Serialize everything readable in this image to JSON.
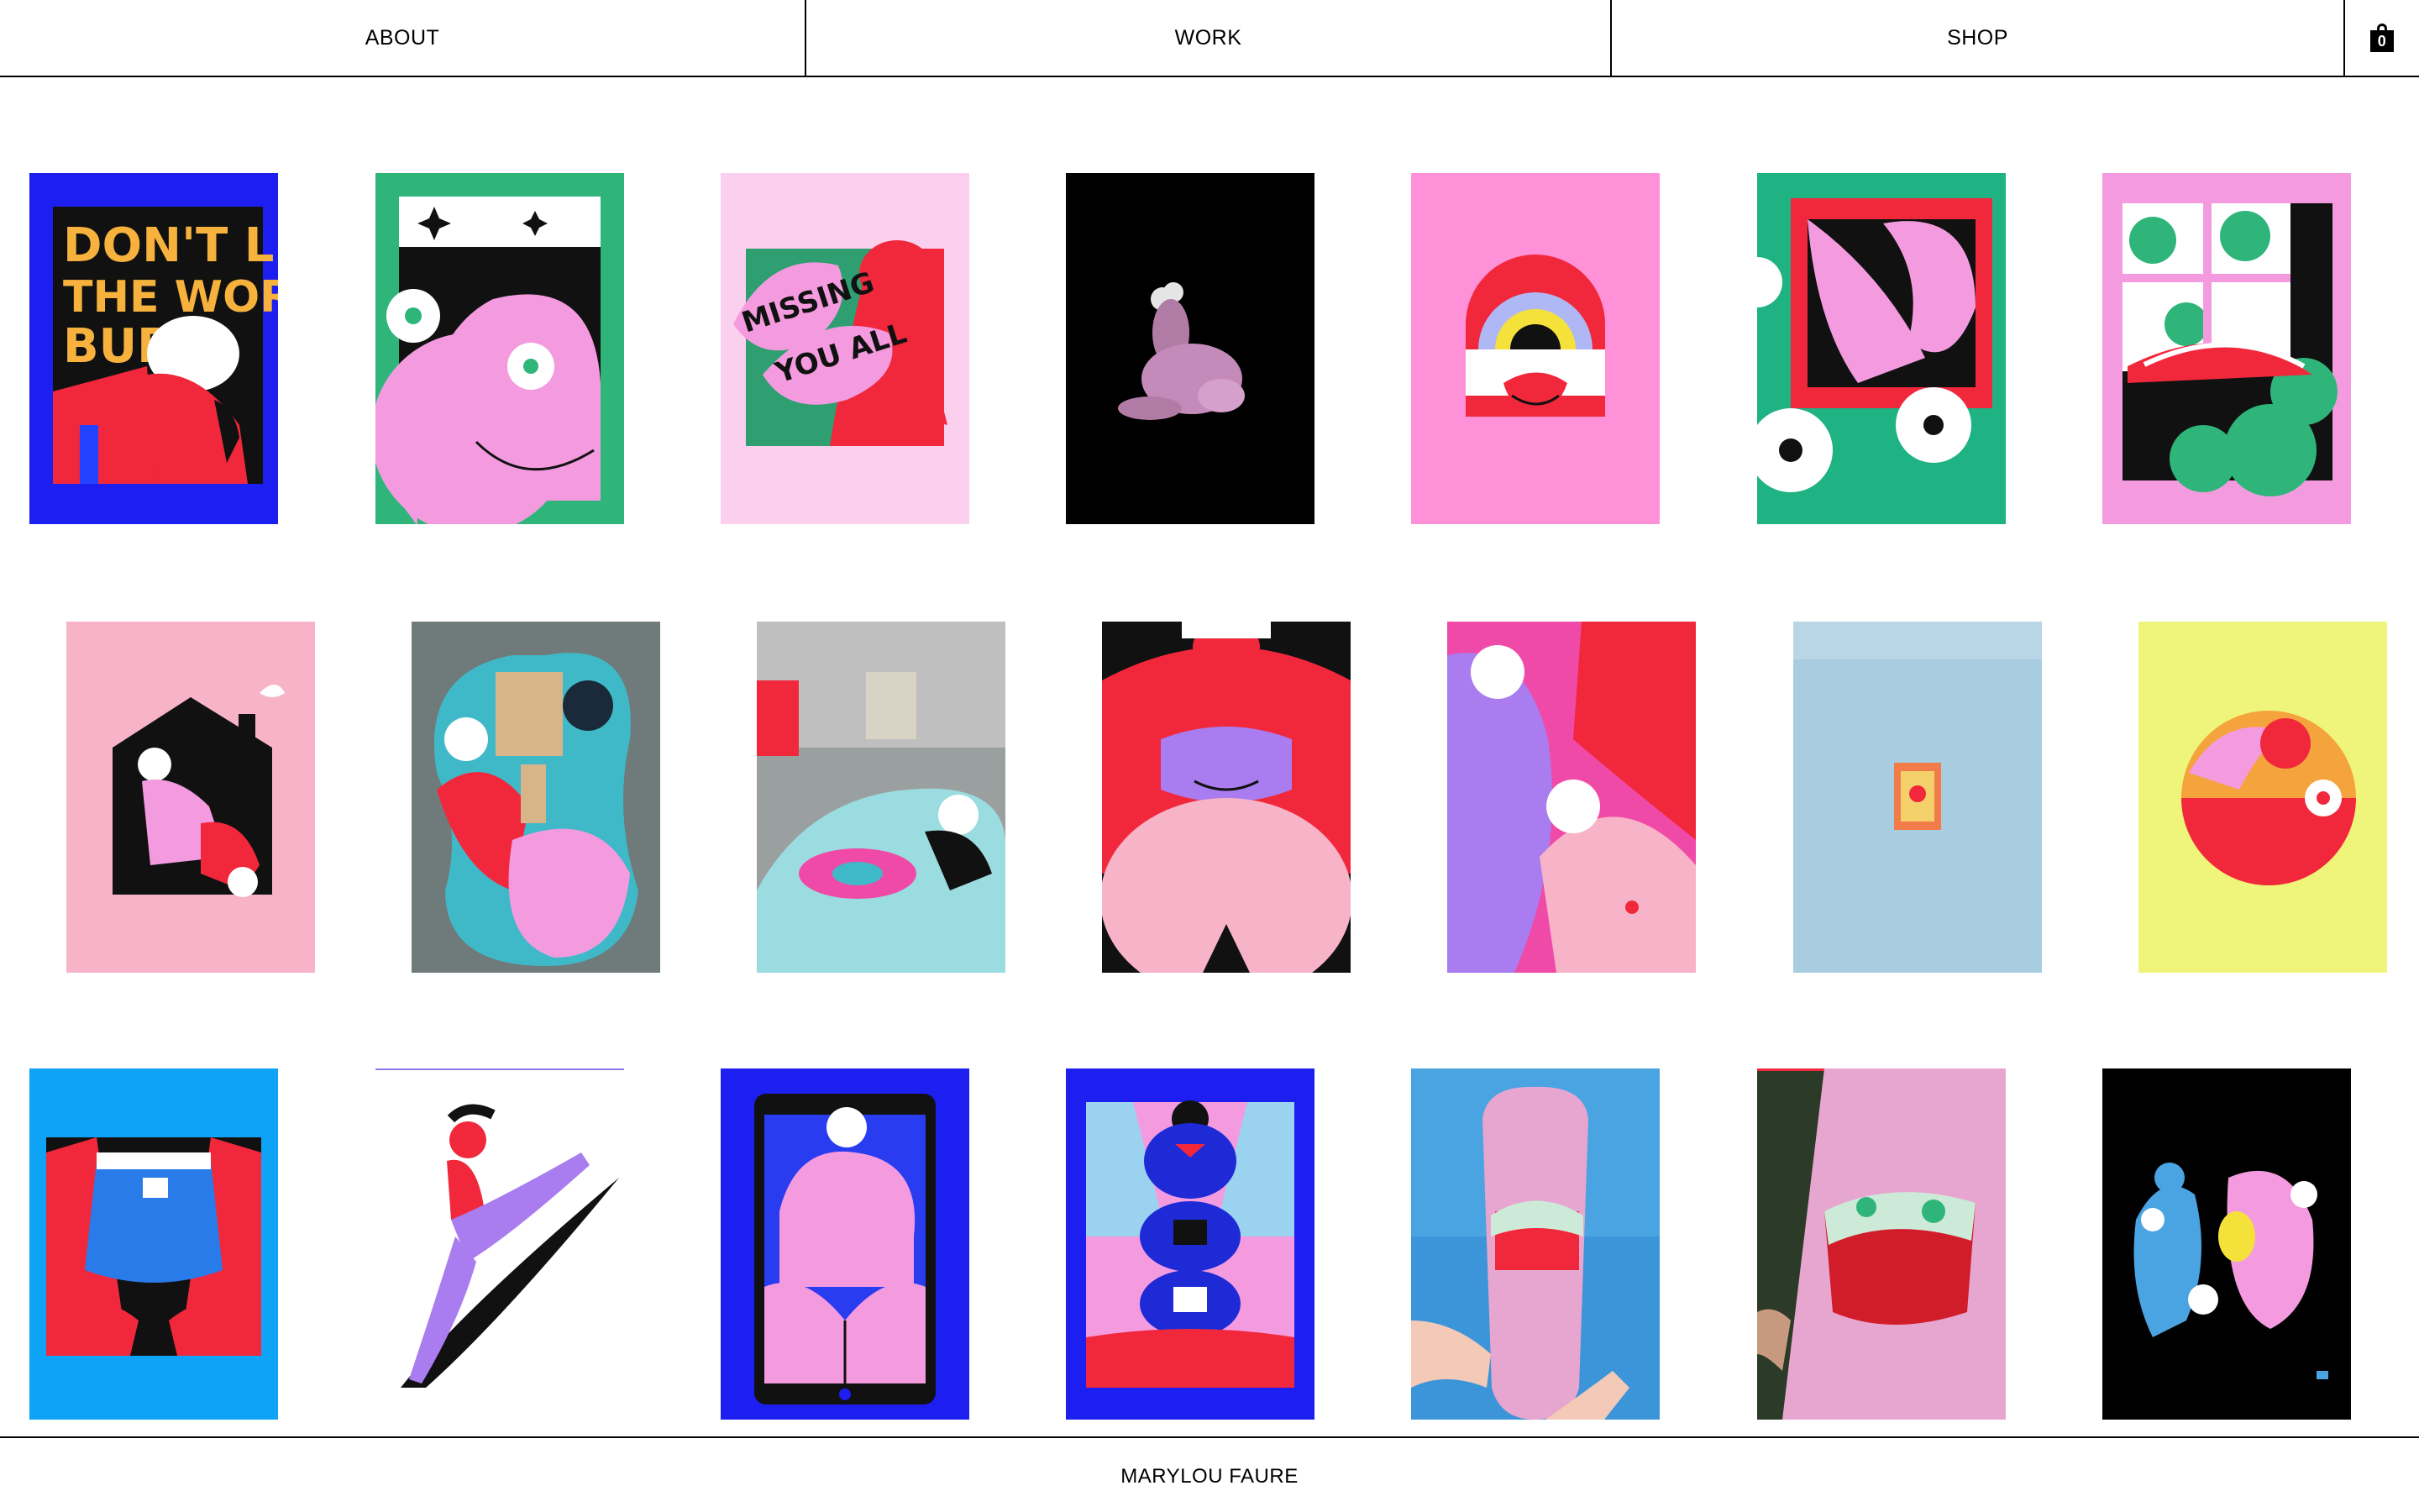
{
  "nav": {
    "about_label": "ABOUT",
    "work_label": "WORK",
    "shop_label": "SHOP",
    "cart_count": "0",
    "cart_icon": "shopping-bag-icon"
  },
  "gallery": {
    "artworks": [
      {
        "slug": "dont-let-the-world-burn",
        "lettering": "DON'T LET THE WORLD BURN"
      },
      {
        "slug": "pink-figure-green-frame"
      },
      {
        "slug": "missing-you-all",
        "lettering": "MISSING YOU ALL"
      },
      {
        "slug": "3d-pink-figure-black"
      },
      {
        "slug": "rainbow-hands"
      },
      {
        "slug": "green-flowers-window"
      },
      {
        "slug": "pink-window-flowers"
      },
      {
        "slug": "house-figure"
      },
      {
        "slug": "painted-guitar-body-top"
      },
      {
        "slug": "painted-guitar-body-angle"
      },
      {
        "slug": "red-purple-figure"
      },
      {
        "slug": "purple-red-figures"
      },
      {
        "slug": "small-print-on-blue"
      },
      {
        "slug": "yellow-circle-figure"
      },
      {
        "slug": "denim-shorts"
      },
      {
        "slug": "kicking-figure"
      },
      {
        "slug": "phone-screen-figure"
      },
      {
        "slug": "stacked-figures"
      },
      {
        "slug": "skateboard-deck-sky"
      },
      {
        "slug": "skateboard-deck-closeup"
      },
      {
        "slug": "blue-pink-figures-black"
      }
    ]
  },
  "colors": {
    "brand_black": "#000000",
    "background": "#ffffff",
    "pink": "#f5a3d6",
    "red": "#f1283c",
    "green": "#2fb57a",
    "blue": "#1d1ef0",
    "purple": "#a97cf0"
  },
  "footer": {
    "name": "MARYLOU FAURE"
  }
}
